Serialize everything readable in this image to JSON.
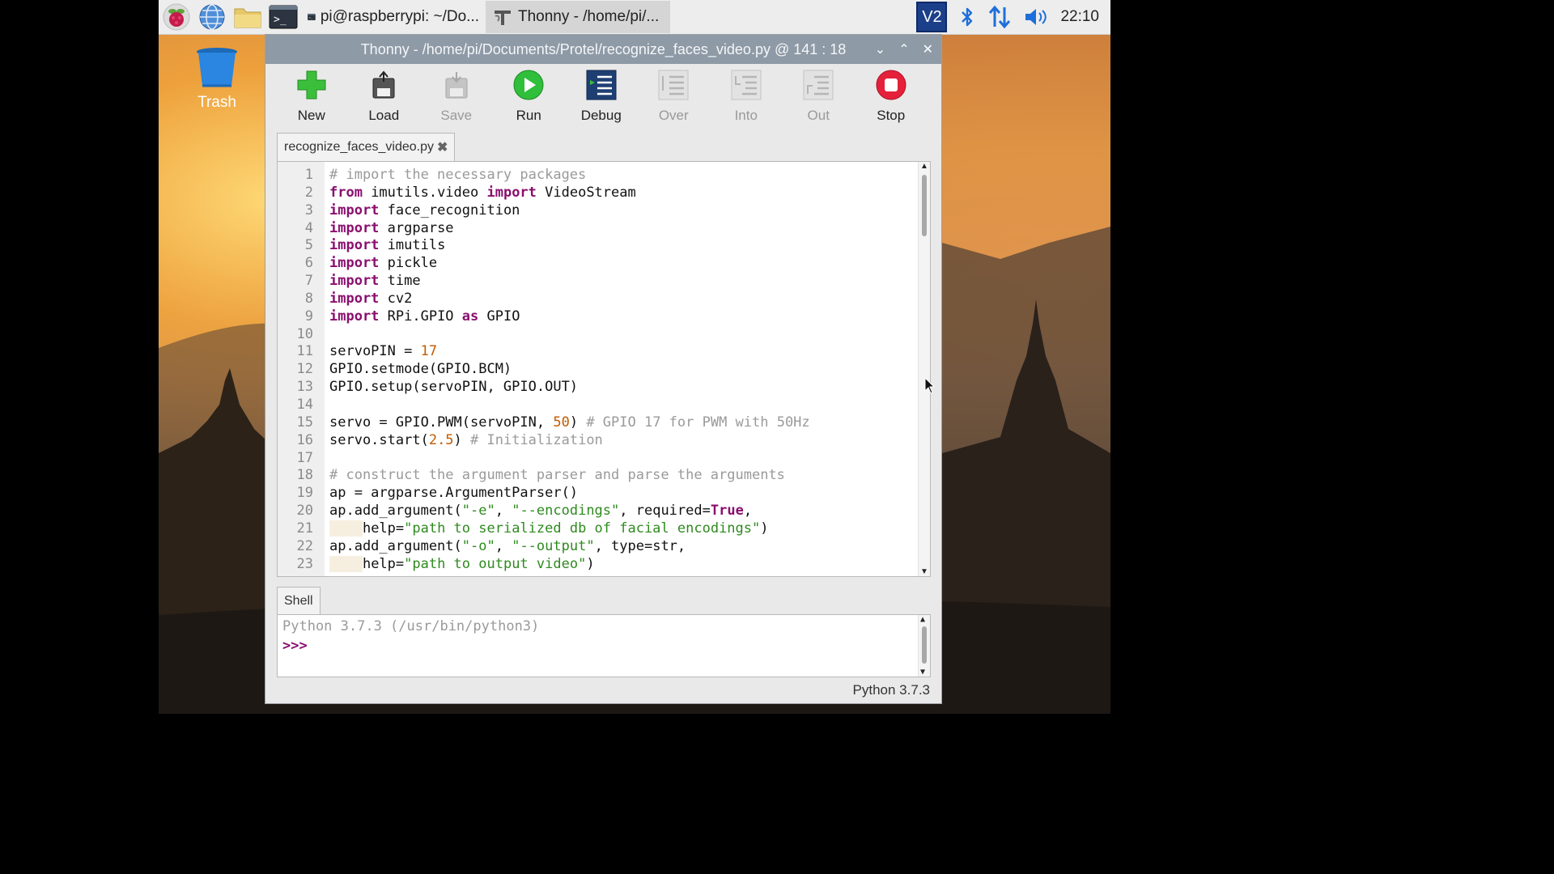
{
  "taskbar": {
    "terminal_task_label": "pi@raspberrypi: ~/Do...",
    "thonny_task_label": "Thonny  -  /home/pi/...",
    "clock": "22:10"
  },
  "desktop": {
    "trash_label": "Trash"
  },
  "window": {
    "title": "Thonny  -  /home/pi/Documents/Protel/recognize_faces_video.py  @  141 : 18"
  },
  "toolbar": {
    "new": "New",
    "load": "Load",
    "save": "Save",
    "run": "Run",
    "debug": "Debug",
    "over": "Over",
    "into": "Into",
    "out": "Out",
    "stop": "Stop"
  },
  "editor": {
    "tab_label": "recognize_faces_video.py",
    "lines": [
      {
        "n": "1",
        "t": "# import the necessary packages"
      },
      {
        "n": "2",
        "t": "from imutils.video import VideoStream"
      },
      {
        "n": "3",
        "t": "import face_recognition"
      },
      {
        "n": "4",
        "t": "import argparse"
      },
      {
        "n": "5",
        "t": "import imutils"
      },
      {
        "n": "6",
        "t": "import pickle"
      },
      {
        "n": "7",
        "t": "import time"
      },
      {
        "n": "8",
        "t": "import cv2"
      },
      {
        "n": "9",
        "t": "import RPi.GPIO as GPIO"
      },
      {
        "n": "10",
        "t": ""
      },
      {
        "n": "11",
        "t": "servoPIN = 17"
      },
      {
        "n": "12",
        "t": "GPIO.setmode(GPIO.BCM)"
      },
      {
        "n": "13",
        "t": "GPIO.setup(servoPIN, GPIO.OUT)"
      },
      {
        "n": "14",
        "t": ""
      },
      {
        "n": "15",
        "t": "servo = GPIO.PWM(servoPIN, 50) # GPIO 17 for PWM with 50Hz"
      },
      {
        "n": "16",
        "t": "servo.start(2.5) # Initialization"
      },
      {
        "n": "17",
        "t": ""
      },
      {
        "n": "18",
        "t": "# construct the argument parser and parse the arguments"
      },
      {
        "n": "19",
        "t": "ap = argparse.ArgumentParser()"
      },
      {
        "n": "20",
        "t": "ap.add_argument(\"-e\", \"--encodings\", required=True,"
      },
      {
        "n": "21",
        "t": "    help=\"path to serialized db of facial encodings\")"
      },
      {
        "n": "22",
        "t": "ap.add_argument(\"-o\", \"--output\", type=str,"
      },
      {
        "n": "23",
        "t": "    help=\"path to output video\")"
      }
    ]
  },
  "shell": {
    "tab_label": "Shell",
    "banner": "Python 3.7.3 (/usr/bin/python3)",
    "prompt": ">>>"
  },
  "status": {
    "python_version": "Python 3.7.3"
  }
}
